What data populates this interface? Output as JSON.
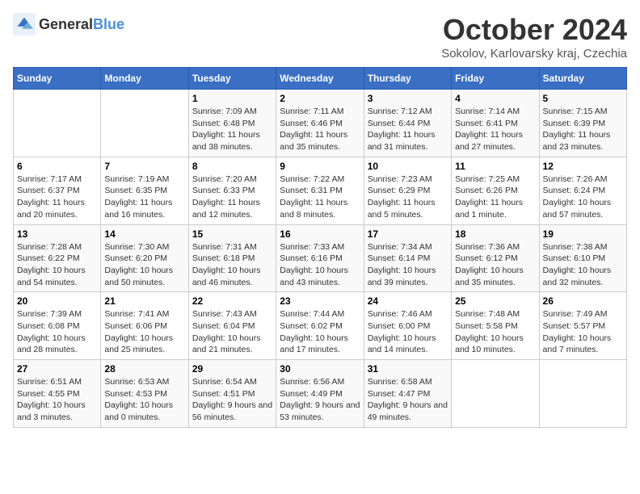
{
  "header": {
    "logo_general": "General",
    "logo_blue": "Blue",
    "month_title": "October 2024",
    "location": "Sokolov, Karlovarsky kraj, Czechia"
  },
  "days_of_week": [
    "Sunday",
    "Monday",
    "Tuesday",
    "Wednesday",
    "Thursday",
    "Friday",
    "Saturday"
  ],
  "weeks": [
    [
      {
        "day": "",
        "info": ""
      },
      {
        "day": "",
        "info": ""
      },
      {
        "day": "1",
        "sunrise": "Sunrise: 7:09 AM",
        "sunset": "Sunset: 6:48 PM",
        "daylight": "Daylight: 11 hours and 38 minutes."
      },
      {
        "day": "2",
        "sunrise": "Sunrise: 7:11 AM",
        "sunset": "Sunset: 6:46 PM",
        "daylight": "Daylight: 11 hours and 35 minutes."
      },
      {
        "day": "3",
        "sunrise": "Sunrise: 7:12 AM",
        "sunset": "Sunset: 6:44 PM",
        "daylight": "Daylight: 11 hours and 31 minutes."
      },
      {
        "day": "4",
        "sunrise": "Sunrise: 7:14 AM",
        "sunset": "Sunset: 6:41 PM",
        "daylight": "Daylight: 11 hours and 27 minutes."
      },
      {
        "day": "5",
        "sunrise": "Sunrise: 7:15 AM",
        "sunset": "Sunset: 6:39 PM",
        "daylight": "Daylight: 11 hours and 23 minutes."
      }
    ],
    [
      {
        "day": "6",
        "sunrise": "Sunrise: 7:17 AM",
        "sunset": "Sunset: 6:37 PM",
        "daylight": "Daylight: 11 hours and 20 minutes."
      },
      {
        "day": "7",
        "sunrise": "Sunrise: 7:19 AM",
        "sunset": "Sunset: 6:35 PM",
        "daylight": "Daylight: 11 hours and 16 minutes."
      },
      {
        "day": "8",
        "sunrise": "Sunrise: 7:20 AM",
        "sunset": "Sunset: 6:33 PM",
        "daylight": "Daylight: 11 hours and 12 minutes."
      },
      {
        "day": "9",
        "sunrise": "Sunrise: 7:22 AM",
        "sunset": "Sunset: 6:31 PM",
        "daylight": "Daylight: 11 hours and 8 minutes."
      },
      {
        "day": "10",
        "sunrise": "Sunrise: 7:23 AM",
        "sunset": "Sunset: 6:29 PM",
        "daylight": "Daylight: 11 hours and 5 minutes."
      },
      {
        "day": "11",
        "sunrise": "Sunrise: 7:25 AM",
        "sunset": "Sunset: 6:26 PM",
        "daylight": "Daylight: 11 hours and 1 minute."
      },
      {
        "day": "12",
        "sunrise": "Sunrise: 7:26 AM",
        "sunset": "Sunset: 6:24 PM",
        "daylight": "Daylight: 10 hours and 57 minutes."
      }
    ],
    [
      {
        "day": "13",
        "sunrise": "Sunrise: 7:28 AM",
        "sunset": "Sunset: 6:22 PM",
        "daylight": "Daylight: 10 hours and 54 minutes."
      },
      {
        "day": "14",
        "sunrise": "Sunrise: 7:30 AM",
        "sunset": "Sunset: 6:20 PM",
        "daylight": "Daylight: 10 hours and 50 minutes."
      },
      {
        "day": "15",
        "sunrise": "Sunrise: 7:31 AM",
        "sunset": "Sunset: 6:18 PM",
        "daylight": "Daylight: 10 hours and 46 minutes."
      },
      {
        "day": "16",
        "sunrise": "Sunrise: 7:33 AM",
        "sunset": "Sunset: 6:16 PM",
        "daylight": "Daylight: 10 hours and 43 minutes."
      },
      {
        "day": "17",
        "sunrise": "Sunrise: 7:34 AM",
        "sunset": "Sunset: 6:14 PM",
        "daylight": "Daylight: 10 hours and 39 minutes."
      },
      {
        "day": "18",
        "sunrise": "Sunrise: 7:36 AM",
        "sunset": "Sunset: 6:12 PM",
        "daylight": "Daylight: 10 hours and 35 minutes."
      },
      {
        "day": "19",
        "sunrise": "Sunrise: 7:38 AM",
        "sunset": "Sunset: 6:10 PM",
        "daylight": "Daylight: 10 hours and 32 minutes."
      }
    ],
    [
      {
        "day": "20",
        "sunrise": "Sunrise: 7:39 AM",
        "sunset": "Sunset: 6:08 PM",
        "daylight": "Daylight: 10 hours and 28 minutes."
      },
      {
        "day": "21",
        "sunrise": "Sunrise: 7:41 AM",
        "sunset": "Sunset: 6:06 PM",
        "daylight": "Daylight: 10 hours and 25 minutes."
      },
      {
        "day": "22",
        "sunrise": "Sunrise: 7:43 AM",
        "sunset": "Sunset: 6:04 PM",
        "daylight": "Daylight: 10 hours and 21 minutes."
      },
      {
        "day": "23",
        "sunrise": "Sunrise: 7:44 AM",
        "sunset": "Sunset: 6:02 PM",
        "daylight": "Daylight: 10 hours and 17 minutes."
      },
      {
        "day": "24",
        "sunrise": "Sunrise: 7:46 AM",
        "sunset": "Sunset: 6:00 PM",
        "daylight": "Daylight: 10 hours and 14 minutes."
      },
      {
        "day": "25",
        "sunrise": "Sunrise: 7:48 AM",
        "sunset": "Sunset: 5:58 PM",
        "daylight": "Daylight: 10 hours and 10 minutes."
      },
      {
        "day": "26",
        "sunrise": "Sunrise: 7:49 AM",
        "sunset": "Sunset: 5:57 PM",
        "daylight": "Daylight: 10 hours and 7 minutes."
      }
    ],
    [
      {
        "day": "27",
        "sunrise": "Sunrise: 6:51 AM",
        "sunset": "Sunset: 4:55 PM",
        "daylight": "Daylight: 10 hours and 3 minutes."
      },
      {
        "day": "28",
        "sunrise": "Sunrise: 6:53 AM",
        "sunset": "Sunset: 4:53 PM",
        "daylight": "Daylight: 10 hours and 0 minutes."
      },
      {
        "day": "29",
        "sunrise": "Sunrise: 6:54 AM",
        "sunset": "Sunset: 4:51 PM",
        "daylight": "Daylight: 9 hours and 56 minutes."
      },
      {
        "day": "30",
        "sunrise": "Sunrise: 6:56 AM",
        "sunset": "Sunset: 4:49 PM",
        "daylight": "Daylight: 9 hours and 53 minutes."
      },
      {
        "day": "31",
        "sunrise": "Sunrise: 6:58 AM",
        "sunset": "Sunset: 4:47 PM",
        "daylight": "Daylight: 9 hours and 49 minutes."
      },
      {
        "day": "",
        "info": ""
      },
      {
        "day": "",
        "info": ""
      }
    ]
  ]
}
